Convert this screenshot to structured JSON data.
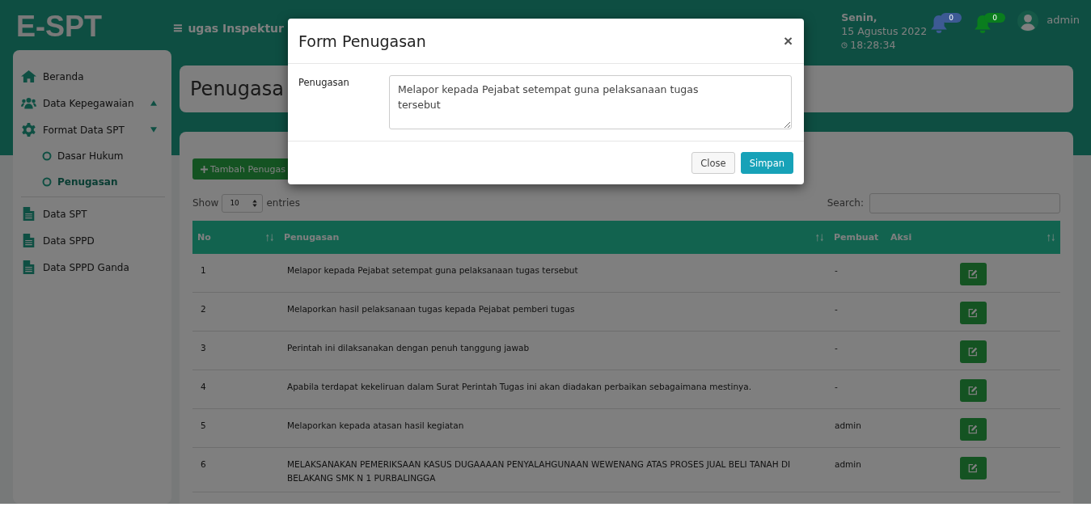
{
  "header": {
    "logo": "E-SPT",
    "menu_icon": "≡",
    "marquee": "ugas Inspektur",
    "day": "Senin,",
    "date": "15 Agustus 2022",
    "time": "18:28:34",
    "notifications": [
      {
        "count": "0",
        "color": "#3d5a94"
      },
      {
        "count": "0",
        "color": "#0a7d1e"
      }
    ],
    "user": "admin"
  },
  "sidebar": {
    "items": [
      {
        "label": "Beranda",
        "kind": "link"
      },
      {
        "label": "Data Kepegawaian",
        "kind": "group",
        "expanded": false
      },
      {
        "label": "Format Data SPT",
        "kind": "group",
        "expanded": true,
        "children": [
          {
            "label": "Dasar Hukum",
            "selected": false
          },
          {
            "label": "Penugasan",
            "selected": true
          }
        ]
      },
      {
        "label": "Data SPT",
        "kind": "link"
      },
      {
        "label": "Data SPPD",
        "kind": "link"
      },
      {
        "label": "Data SPPD Ganda",
        "kind": "link"
      }
    ]
  },
  "page_title": "Penugasa",
  "add_button": "Tambah Penugas",
  "table": {
    "show_label": "Show",
    "page_size": "10",
    "entries_label": "entries",
    "search_label": "Search:",
    "columns": [
      "No",
      "Penugasan",
      "Pembuat",
      "Aksi"
    ],
    "rows": [
      {
        "no": "1",
        "penugasan": "Melapor kepada Pejabat setempat guna pelaksanaan tugas tersebut",
        "pembuat": "-"
      },
      {
        "no": "2",
        "penugasan": "Melaporkan hasil pelaksanaan tugas kepada Pejabat pemberi tugas",
        "pembuat": "-"
      },
      {
        "no": "3",
        "penugasan": "Perintah ini dilaksanakan dengan penuh tanggung jawab",
        "pembuat": "-"
      },
      {
        "no": "4",
        "penugasan": "Apabila terdapat kekeliruan dalam Surat Perintah Tugas ini akan diadakan perbaikan sebagaimana mestinya.",
        "pembuat": "-"
      },
      {
        "no": "5",
        "penugasan": "Melaporkan kepada atasan hasil kegiatan",
        "pembuat": "admin"
      },
      {
        "no": "6",
        "penugasan": "MELAKSANAKAN PEMERIKSAAN KASUS DUGAAAAN PENYALAHGUNAAN WEWENANG ATAS PROSES JUAL BELI TANAH DI BELAKANG SMK N 1 PURBALINGGA",
        "pembuat": "admin"
      }
    ]
  },
  "modal": {
    "title": "Form Penugasan",
    "close_icon": "×",
    "field_label": "Penugasan",
    "field_value": "Melapor kepada Pejabat setempat guna pelaksanaan tugas tersebut",
    "buttons": [
      {
        "label": "Close",
        "kind": "secondary"
      },
      {
        "label": "Simpan",
        "kind": "primary"
      }
    ]
  }
}
